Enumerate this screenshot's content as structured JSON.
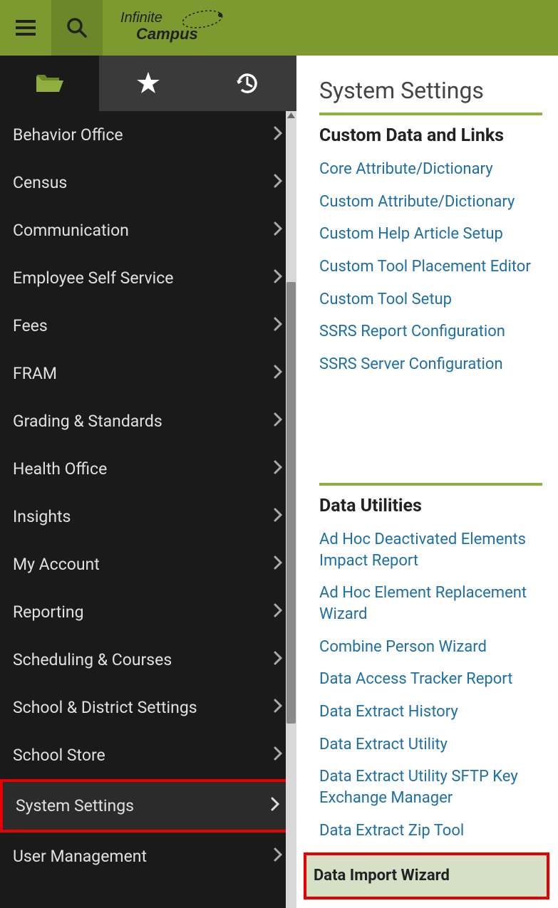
{
  "logo": {
    "line1": "Infinite",
    "line2": "Campus"
  },
  "nav": {
    "items": [
      {
        "label": "Behavior Office"
      },
      {
        "label": "Census"
      },
      {
        "label": "Communication"
      },
      {
        "label": "Employee Self Service"
      },
      {
        "label": "Fees"
      },
      {
        "label": "FRAM"
      },
      {
        "label": "Grading & Standards"
      },
      {
        "label": "Health Office"
      },
      {
        "label": "Insights"
      },
      {
        "label": "My Account"
      },
      {
        "label": "Reporting"
      },
      {
        "label": "Scheduling & Courses"
      },
      {
        "label": "School & District Settings"
      },
      {
        "label": "School Store"
      },
      {
        "label": "System Settings"
      },
      {
        "label": "User Management"
      }
    ]
  },
  "content": {
    "title": "System Settings",
    "section1": {
      "heading": "Custom Data and Links",
      "links": [
        "Core Attribute/Dictionary",
        "Custom Attribute/Dictionary",
        "Custom Help Article Setup",
        "Custom Tool Placement Editor",
        "Custom Tool Setup",
        "SSRS Report Configuration",
        "SSRS Server Configuration"
      ]
    },
    "section2": {
      "heading": "Data Utilities",
      "links": [
        "Ad Hoc Deactivated Elements Impact Report",
        "Ad Hoc Element Replacement Wizard",
        "Combine Person Wizard",
        "Data Access Tracker Report",
        "Data Extract History",
        "Data Extract Utility",
        "Data Extract Utility SFTP Key Exchange Manager",
        "Data Extract Zip Tool",
        "Data Import Wizard"
      ]
    }
  }
}
